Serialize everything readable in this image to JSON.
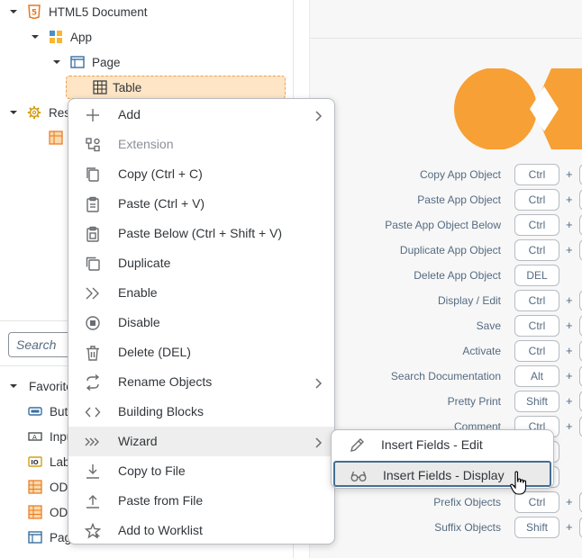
{
  "tree": {
    "nodes": [
      {
        "label": "HTML5 Document",
        "icon": "html5-icon"
      },
      {
        "label": "App",
        "icon": "app-icon"
      },
      {
        "label": "Page",
        "icon": "page-icon"
      },
      {
        "label": "Table",
        "icon": "table-icon"
      },
      {
        "label": "Res",
        "icon": "gear-icon"
      }
    ]
  },
  "search": {
    "placeholder": "Search"
  },
  "favorites": {
    "header": "Favorite",
    "items": [
      {
        "label": "Butt",
        "icon": "button-icon"
      },
      {
        "label": "Inpu",
        "icon": "input-icon"
      },
      {
        "label": "Lab",
        "icon": "label-icon"
      },
      {
        "label": "ODa",
        "icon": "odata-icon"
      },
      {
        "label": "ODa",
        "icon": "odata-icon"
      },
      {
        "label": "Pag",
        "icon": "page-icon"
      }
    ]
  },
  "context_menu": {
    "items": [
      {
        "label": "Add",
        "icon": "plus-icon",
        "submenu": true
      },
      {
        "label": "Extension",
        "icon": "extension-icon",
        "disabled": true
      },
      {
        "label": "Copy (Ctrl + C)",
        "icon": "copy-icon"
      },
      {
        "label": "Paste (Ctrl + V)",
        "icon": "paste-icon"
      },
      {
        "label": "Paste Below (Ctrl + Shift + V)",
        "icon": "paste-below-icon"
      },
      {
        "label": "Duplicate",
        "icon": "duplicate-icon"
      },
      {
        "label": "Enable",
        "icon": "enable-icon"
      },
      {
        "label": "Disable",
        "icon": "disable-icon"
      },
      {
        "label": "Delete (DEL)",
        "icon": "trash-icon"
      },
      {
        "label": "Rename Objects",
        "icon": "rename-icon",
        "submenu": true
      },
      {
        "label": "Building Blocks",
        "icon": "code-icon"
      },
      {
        "label": "Wizard",
        "icon": "wizard-icon",
        "submenu": true,
        "active": true
      },
      {
        "label": "Copy to File",
        "icon": "download-icon"
      },
      {
        "label": "Paste from File",
        "icon": "upload-icon"
      },
      {
        "label": "Add to Worklist",
        "icon": "star-icon"
      }
    ]
  },
  "wizard_submenu": {
    "items": [
      {
        "label": "Insert Fields - Edit",
        "icon": "pencil-icon"
      },
      {
        "label": "Insert Fields - Display",
        "icon": "glasses-icon",
        "focused": true
      }
    ]
  },
  "shortcuts": [
    {
      "label": "Copy App Object",
      "key": "Ctrl",
      "plus": true
    },
    {
      "label": "Paste App Object",
      "key": "Ctrl",
      "plus": true
    },
    {
      "label": "Paste App Object Below",
      "key": "Ctrl",
      "plus": true
    },
    {
      "label": "Duplicate App Object",
      "key": "Ctrl",
      "plus": true
    },
    {
      "label": "Delete App Object",
      "key": "DEL",
      "plus": false
    },
    {
      "label": "Display / Edit",
      "key": "Ctrl",
      "plus": true
    },
    {
      "label": "Save",
      "key": "Ctrl",
      "plus": true
    },
    {
      "label": "Activate",
      "key": "Ctrl",
      "plus": true
    },
    {
      "label": "Search Documentation",
      "key": "Alt",
      "plus": true
    },
    {
      "label": "Pretty Print",
      "key": "Shift",
      "plus": true
    },
    {
      "label": "Comment",
      "key": "Ctrl",
      "plus": true
    },
    {
      "label": "",
      "key": "",
      "plus": false
    },
    {
      "label": "",
      "key": "",
      "plus": false
    },
    {
      "label": "Prefix Objects",
      "key": "Ctrl",
      "plus": true
    },
    {
      "label": "Suffix Objects",
      "key": "Shift",
      "plus": true
    }
  ],
  "colors": {
    "accent_orange": "#f7a035",
    "selection_bg": "#fde5c6",
    "focus_border": "#436e94"
  }
}
